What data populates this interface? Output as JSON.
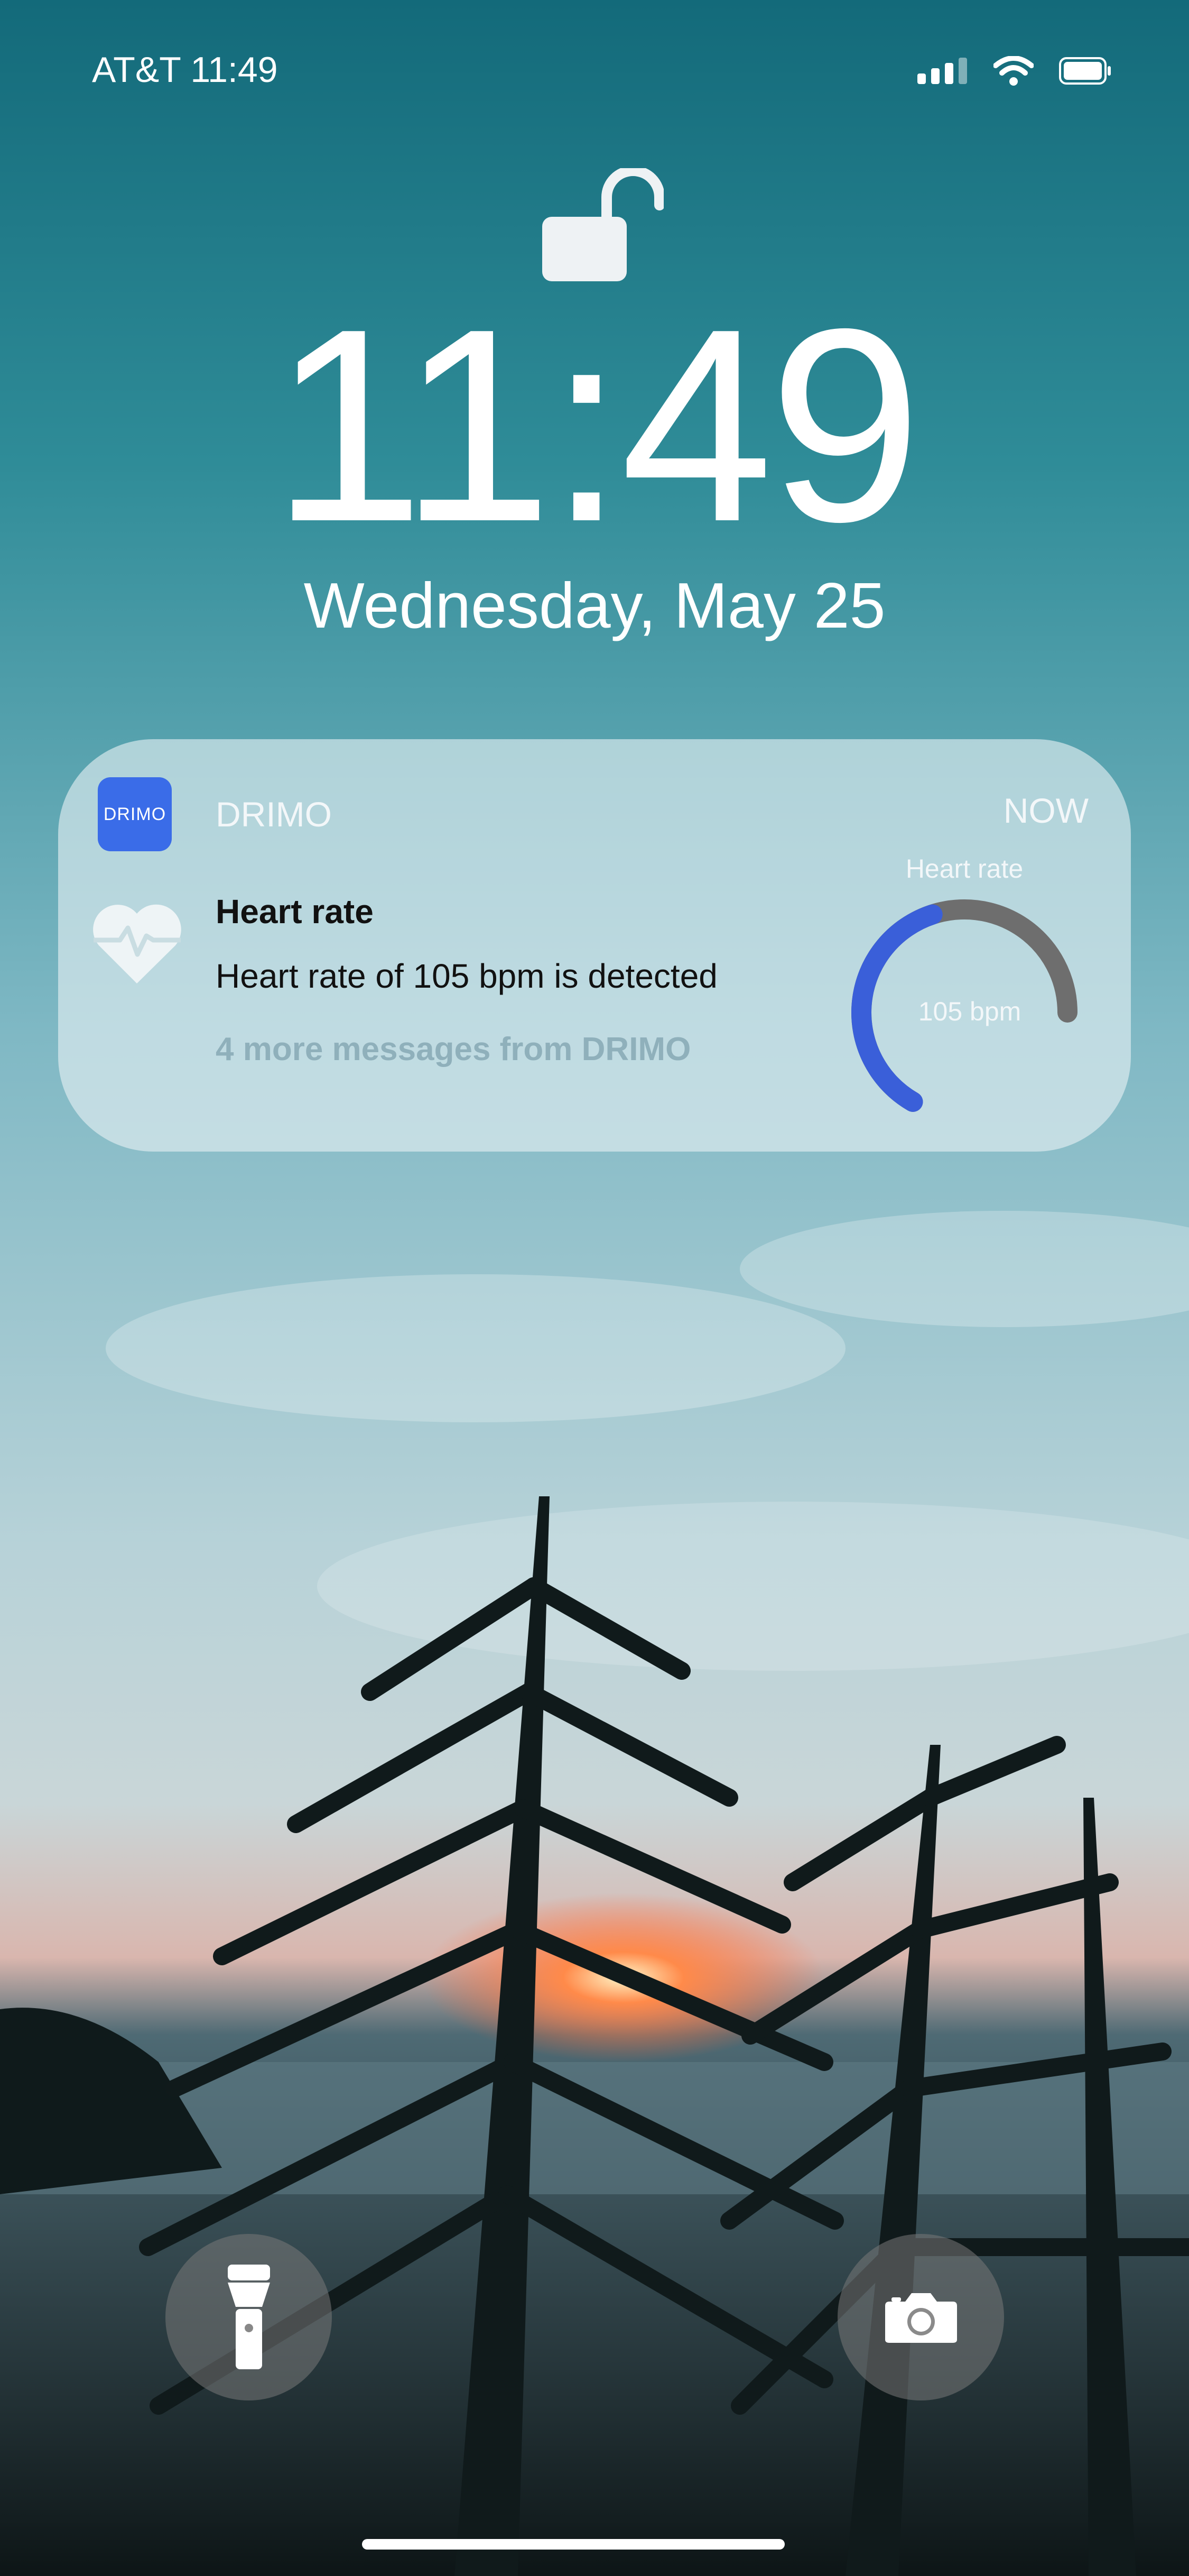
{
  "status_bar": {
    "carrier_time": "AT&T  11:49"
  },
  "lock_screen": {
    "time": "11:49",
    "date": "Wednesday, May 25"
  },
  "notification": {
    "app_icon_text": "DRIMO",
    "app_name": "DRIMO",
    "time": "NOW",
    "title": "Heart rate",
    "body": "Heart rate of 105 bpm is detected",
    "more": "4 more messages from DRIMO",
    "gauge": {
      "label": "Heart rate",
      "value_label": "105 bpm",
      "fill_fraction": 0.55
    }
  },
  "colors": {
    "accent": "#3a5fd9",
    "gauge_track": "#6e6e6e"
  },
  "icons": [
    "signal-icon",
    "wifi-icon",
    "battery-icon",
    "unlocked-padlock-icon",
    "heart-pulse-icon",
    "flashlight-icon",
    "camera-icon"
  ]
}
